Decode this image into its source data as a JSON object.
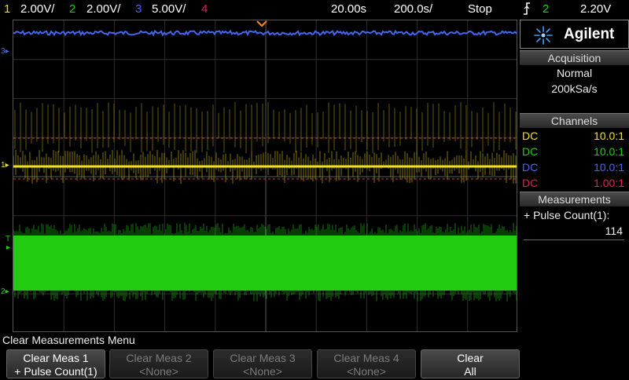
{
  "status_bar": {
    "ch1_label": "1",
    "ch1_scale": "2.00V/",
    "ch2_label": "2",
    "ch2_scale": "2.00V/",
    "ch3_label": "3",
    "ch3_scale": "5.00V/",
    "ch4_label": "4",
    "time_delay": "20.00s",
    "time_base": "200.0s/",
    "run_state": "Stop",
    "trigger_icon": "trigger-edge-icon",
    "trigger_channel": "2",
    "trigger_level": "2.20V"
  },
  "colors": {
    "ch1": "#f0e020",
    "ch2": "#22cc11",
    "ch3": "#4466ee",
    "ch4": "#dd2255"
  },
  "markers": {
    "ch1": "1",
    "ch2": "2",
    "ch3": "3",
    "trigger": "T"
  },
  "panel": {
    "brand": "Agilent",
    "acquisition": {
      "title": "Acquisition",
      "mode": "Normal",
      "rate": "200kSa/s"
    },
    "channels": {
      "title": "Channels",
      "rows": [
        {
          "coupling": "DC",
          "ratio": "10.0:1"
        },
        {
          "coupling": "DC",
          "ratio": "10.0:1"
        },
        {
          "coupling": "DC",
          "ratio": "10.0:1"
        },
        {
          "coupling": "DC",
          "ratio": "1.00:1"
        }
      ]
    },
    "measurements": {
      "title": "Measurements",
      "label": "+ Pulse Count(1):",
      "value": "114"
    }
  },
  "menu": {
    "title": "Clear Measurements Menu",
    "softkeys": [
      {
        "line1": "Clear Meas 1",
        "line2": "+ Pulse Count(1)"
      },
      {
        "line1": "Clear Meas 2",
        "line2": "<None>"
      },
      {
        "line1": "Clear Meas 3",
        "line2": "<None>"
      },
      {
        "line1": "Clear Meas 4",
        "line2": "<None>"
      },
      {
        "line1": "Clear",
        "line2": "All"
      }
    ]
  }
}
